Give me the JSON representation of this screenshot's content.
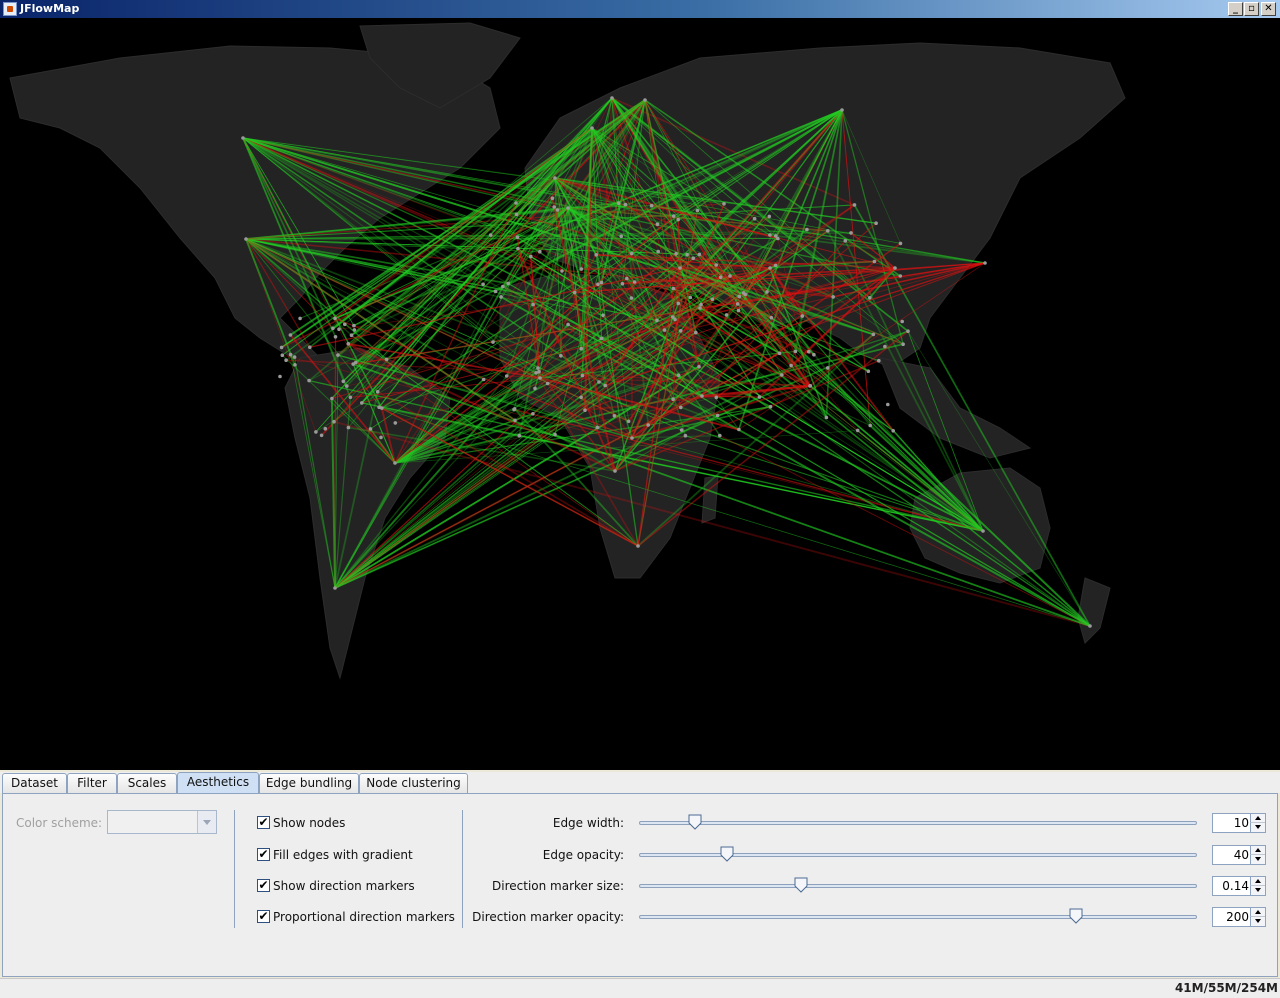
{
  "window": {
    "title": "JFlowMap",
    "minimize_label": "_",
    "maximize_label": "▫",
    "close_label": "✕"
  },
  "map": {
    "background": "#000000",
    "land_color": "#232323",
    "inflow_color": "#22cc22",
    "outflow_color": "#dd1111",
    "node_color": "#9a9a9a"
  },
  "tabs": [
    {
      "label": "Dataset",
      "active": false
    },
    {
      "label": "Filter",
      "active": false
    },
    {
      "label": "Scales",
      "active": false
    },
    {
      "label": "Aesthetics",
      "active": true
    },
    {
      "label": "Edge bundling",
      "active": false
    },
    {
      "label": "Node clustering",
      "active": false
    }
  ],
  "aesthetics": {
    "color_scheme_label": "Color scheme:",
    "color_scheme_value": "",
    "checkboxes": [
      {
        "label": "Show nodes",
        "checked": true,
        "mark": "✔"
      },
      {
        "label": "Fill edges with gradient",
        "checked": true,
        "mark": "✔"
      },
      {
        "label": "Show direction markers",
        "checked": true,
        "mark": "✔"
      },
      {
        "label": "Proportional direction markers",
        "checked": true,
        "mark": "✔"
      }
    ],
    "sliders": [
      {
        "label": "Edge width:",
        "value": "10",
        "fraction": 0.1
      },
      {
        "label": "Edge opacity:",
        "value": "40",
        "fraction": 0.157
      },
      {
        "label": "Direction marker size:",
        "value": "0.14",
        "fraction": 0.29
      },
      {
        "label": "Direction marker opacity:",
        "value": "200",
        "fraction": 0.784
      }
    ]
  },
  "status": {
    "memory": "41M/55M/254M"
  }
}
